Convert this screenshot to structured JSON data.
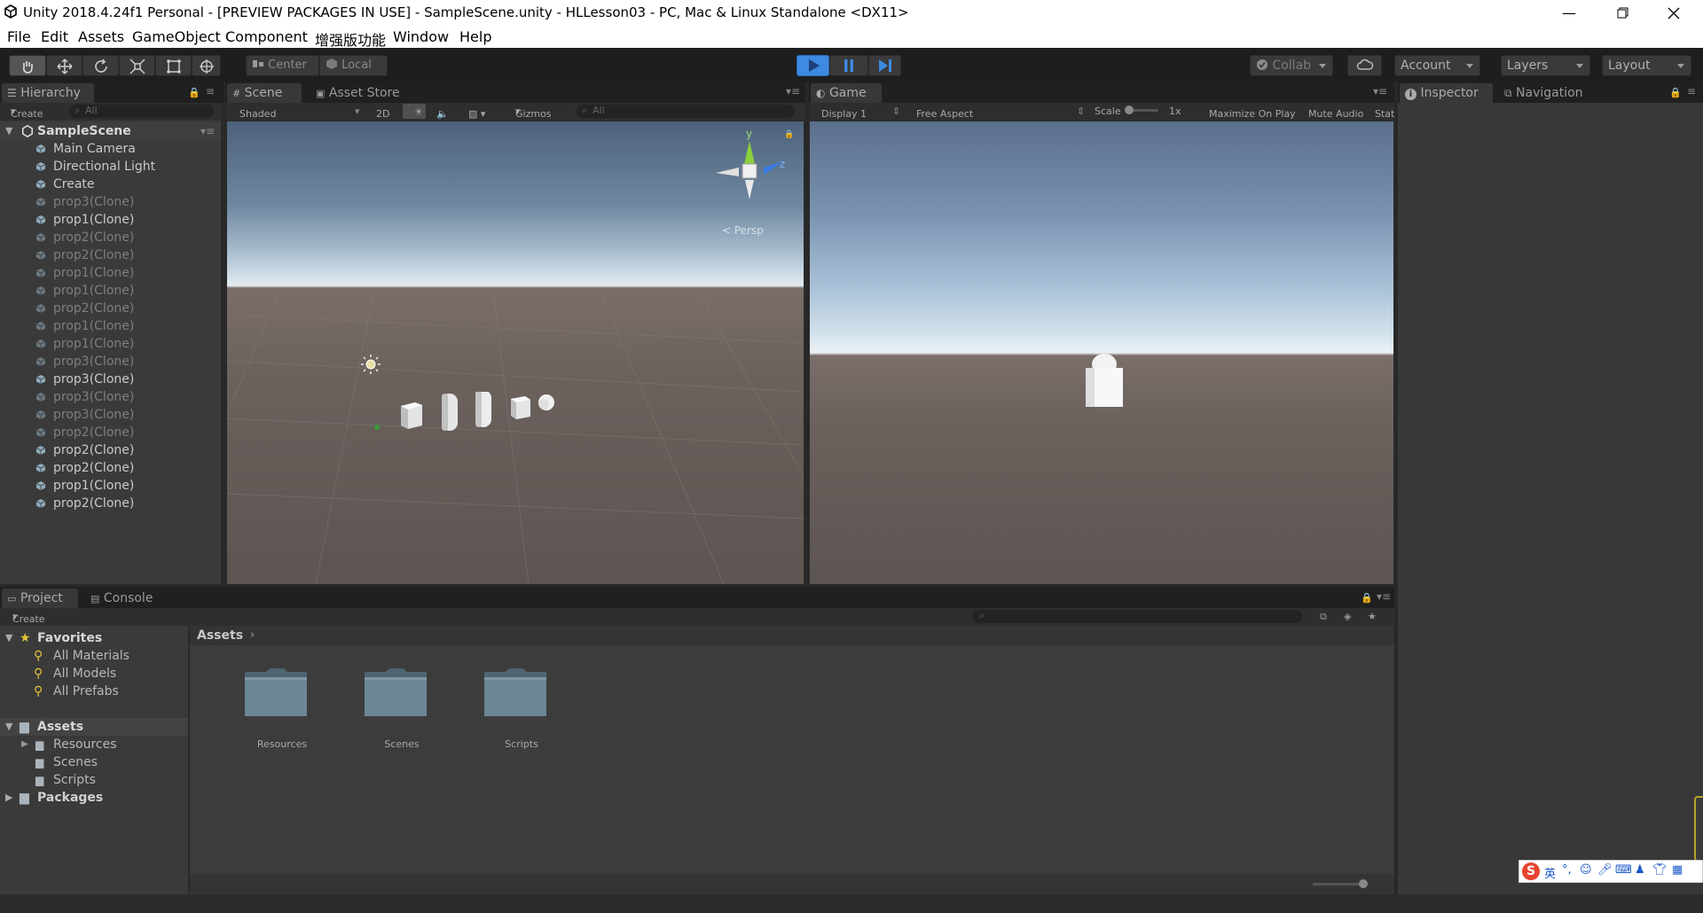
{
  "window": {
    "title": "Unity 2018.4.24f1 Personal - [PREVIEW PACKAGES IN USE] - SampleScene.unity - HLLesson03 - PC, Mac & Linux Standalone <DX11>"
  },
  "menu": [
    "File",
    "Edit",
    "Assets",
    "GameObject",
    "Component",
    "增强版功能",
    "Window",
    "Help"
  ],
  "toolbar": {
    "pivot_label": "Center",
    "space_label": "Local",
    "collab_label": "Collab",
    "account_label": "Account",
    "layers_label": "Layers",
    "layout_label": "Layout"
  },
  "hierarchy": {
    "tab_label": "Hierarchy",
    "create_label": "Create",
    "search_placeholder": "All",
    "scene_name": "SampleScene",
    "items": [
      {
        "name": "Main Camera",
        "active": true
      },
      {
        "name": "Directional Light",
        "active": true
      },
      {
        "name": "Create",
        "active": true
      },
      {
        "name": "prop3(Clone)",
        "active": false
      },
      {
        "name": "prop1(Clone)",
        "active": true
      },
      {
        "name": "prop2(Clone)",
        "active": false
      },
      {
        "name": "prop2(Clone)",
        "active": false
      },
      {
        "name": "prop1(Clone)",
        "active": false
      },
      {
        "name": "prop1(Clone)",
        "active": false
      },
      {
        "name": "prop2(Clone)",
        "active": false
      },
      {
        "name": "prop1(Clone)",
        "active": false
      },
      {
        "name": "prop1(Clone)",
        "active": false
      },
      {
        "name": "prop3(Clone)",
        "active": false
      },
      {
        "name": "prop3(Clone)",
        "active": true
      },
      {
        "name": "prop3(Clone)",
        "active": false
      },
      {
        "name": "prop3(Clone)",
        "active": false
      },
      {
        "name": "prop2(Clone)",
        "active": false
      },
      {
        "name": "prop2(Clone)",
        "active": true
      },
      {
        "name": "prop2(Clone)",
        "active": true
      },
      {
        "name": "prop1(Clone)",
        "active": true
      },
      {
        "name": "prop2(Clone)",
        "active": true
      }
    ]
  },
  "scene_view": {
    "tab_scene": "Scene",
    "tab_asset_store": "Asset Store",
    "shading": "Shaded",
    "mode_2d": "2D",
    "gizmos_label": "Gizmos",
    "search_placeholder": "All",
    "gizmo_y": "y",
    "gizmo_z": "z",
    "persp_label": "< Persp"
  },
  "game_view": {
    "tab_label": "Game",
    "display": "Display 1",
    "aspect": "Free Aspect",
    "scale_label": "Scale",
    "scale_value": "1x",
    "maximize_label": "Maximize On Play",
    "mute_label": "Mute Audio",
    "stats_label": "Stat"
  },
  "inspector": {
    "tab_label": "Inspector",
    "nav_tab_label": "Navigation"
  },
  "project": {
    "tab_label": "Project",
    "console_label": "Console",
    "create_label": "Create",
    "favorites_label": "Favorites",
    "favorites": [
      "All Materials",
      "All Models",
      "All Prefabs"
    ],
    "assets_label": "Assets",
    "asset_folders": [
      "Resources",
      "Scenes",
      "Scripts"
    ],
    "packages_label": "Packages",
    "breadcrumb": "Assets",
    "grid_folders": [
      "Resources",
      "Scenes",
      "Scripts"
    ]
  },
  "ime": {
    "lang": "英"
  },
  "colors": {
    "play_blue": "#3d8ae0",
    "editor_dark": "#383838",
    "toolbar_bg": "#1e1e1e"
  }
}
